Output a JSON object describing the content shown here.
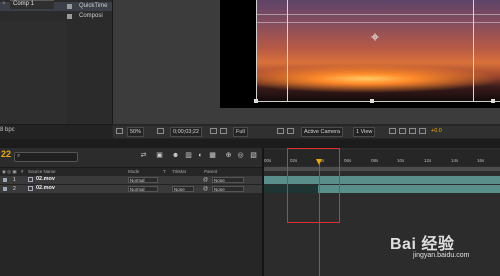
{
  "project": {
    "items": [
      {
        "label": "QuickTime"
      },
      {
        "label": "Composi"
      }
    ],
    "bit_depth": "8 bpc"
  },
  "viewer_toolbar": {
    "zoom": "50%",
    "timecode": "0;00;03;22",
    "resolution": "Full",
    "camera": "Active Camera",
    "view": "1 View",
    "exposure": "+0.0"
  },
  "timeline": {
    "tab_label": "Comp 1",
    "current_time": "22",
    "columns": {
      "source_name": "Source Name",
      "mode": "Mode",
      "t": "T",
      "trkmat": "TrkMat",
      "parent": "Parent"
    },
    "layers": [
      {
        "number": "1",
        "name": "02.mov",
        "mode": "Normal",
        "trkmat": "",
        "parent": "None"
      },
      {
        "number": "2",
        "name": "02.mov",
        "mode": "Normal",
        "trkmat": "None",
        "parent": "None"
      }
    ],
    "ruler_ticks": [
      "00s",
      "02s",
      "04s",
      "06s",
      "08s",
      "10s",
      "12s",
      "14s",
      "16s"
    ]
  },
  "watermark": {
    "text": "Bai 经验",
    "url": "jingyan.baidu.com"
  },
  "colors": {
    "timecode": "#f0a800",
    "track": "#5a8e8a",
    "highlight": "#e23030"
  }
}
